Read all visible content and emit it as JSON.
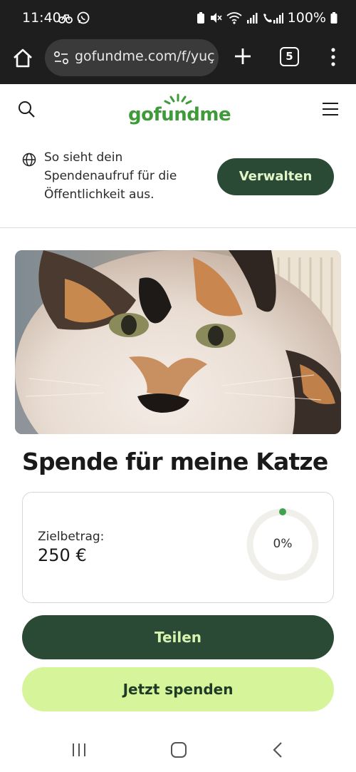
{
  "status_bar": {
    "time": "11:40",
    "battery": "100%"
  },
  "browser": {
    "url": "gofundme.com/f/yuç",
    "tab_count": "5"
  },
  "site": {
    "logo": "gofundme",
    "logo_color": "#3f9a3a"
  },
  "notice": {
    "text": "So sieht dein Spendenaufruf für die Öffentlichkeit aus.",
    "manage_label": "Verwalten"
  },
  "campaign": {
    "title": "Spende für meine Katze",
    "goal_label": "Zielbetrag:",
    "goal_value": "250 €",
    "progress_label": "0%",
    "progress_fraction": 0
  },
  "actions": {
    "share_label": "Teilen",
    "donate_label": "Jetzt spenden"
  },
  "colors": {
    "dark_green": "#2b4a36",
    "light_green": "#d6f59a",
    "accent_green": "#3f9a3a"
  }
}
